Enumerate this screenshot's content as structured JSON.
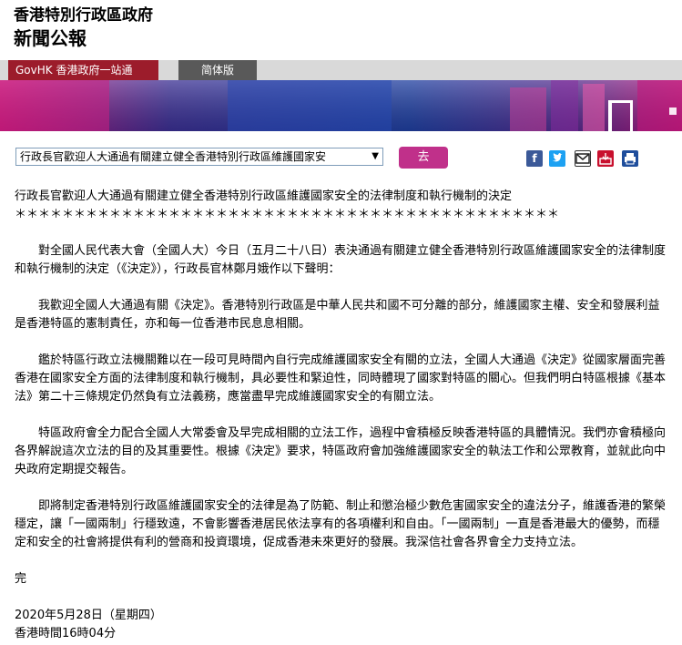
{
  "header": {
    "line1": "香港特別行政區政府",
    "line2": "新聞公報"
  },
  "tabs": {
    "govhk": "GovHK 香港政府一站通",
    "simplified": "简体版"
  },
  "toolbar": {
    "select_value": "行政長官歡迎人大通過有關建立健全香港特別行政區維護國家安",
    "go_label": "去",
    "share_icons": [
      "facebook-icon",
      "twitter-icon",
      "email-icon",
      "inbox-icon",
      "print-icon"
    ]
  },
  "article": {
    "title": "行政長官歡迎人大通過有關建立健全香港特別行政區維護國家安全的法律制度和執行機制的決定",
    "stars": "＊＊＊＊＊＊＊＊＊＊＊＊＊＊＊＊＊＊＊＊＊＊＊＊＊＊＊＊＊＊＊＊＊＊＊＊＊＊＊＊＊＊＊＊＊＊",
    "paragraphs": [
      "對全國人民代表大會（全國人大）今日（五月二十八日）表決通過有關建立健全香港特別行政區維護國家安全的法律制度和執行機制的決定（《決定》），行政長官林鄭月娥作以下聲明：",
      "我歡迎全國人大通過有關《決定》。香港特別行政區是中華人民共和國不可分離的部分，維護國家主權、安全和發展利益是香港特區的憲制責任，亦和每一位香港市民息息相關。",
      "鑑於特區行政立法機關難以在一段可見時間內自行完成維護國家安全有關的立法，全國人大通過《決定》從國家層面完善香港在國家安全方面的法律制度和執行機制，具必要性和緊迫性，同時體現了國家對特區的關心。但我們明白特區根據《基本法》第二十三條規定仍然負有立法義務，應當盡早完成維護國家安全的有關立法。",
      "特區政府會全力配合全國人大常委會及早完成相關的立法工作，過程中會積極反映香港特區的具體情況。我們亦會積極向各界解說這次立法的目的及其重要性。根據《決定》要求，特區政府會加強維護國家安全的執法工作和公眾教育，並就此向中央政府定期提交報告。",
      "即將制定香港特別行政區維護國家安全的法律是為了防範、制止和懲治極少數危害國家安全的違法分子，維護香港的繁榮穩定，讓「一國兩制」行穩致遠，不會影響香港居民依法享有的各項權利和自由。「一國兩制」一直是香港最大的優勢，而穩定和安全的社會將提供有利的營商和投資環境，促成香港未來更好的發展。我深信社會各界會全力支持立法。"
    ],
    "end": "完",
    "date": "2020年5月28日（星期四）",
    "time": "香港時間16時04分"
  },
  "colors": {
    "tab_gov": "#9c1c2b",
    "tab_simplified": "#595959",
    "go_button": "#c0308a",
    "banner_blue": "#1f3a93",
    "banner_magenta": "#b5177a"
  }
}
